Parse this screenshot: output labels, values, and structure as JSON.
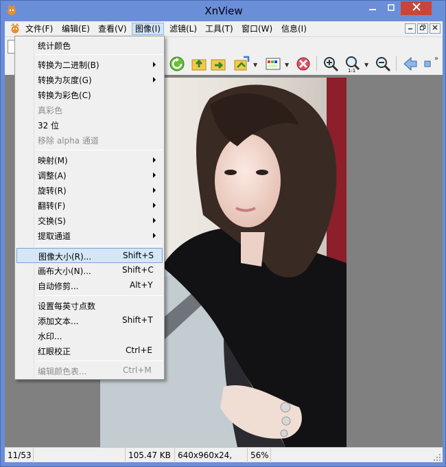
{
  "window": {
    "title": "XnView"
  },
  "menubar": {
    "items": [
      {
        "label": "文件(F)"
      },
      {
        "label": "编辑(E)"
      },
      {
        "label": "查看(V)"
      },
      {
        "label": "图像(I)"
      },
      {
        "label": "滤镜(L)"
      },
      {
        "label": "工具(T)"
      },
      {
        "label": "窗口(W)"
      },
      {
        "label": "信息(I)"
      }
    ]
  },
  "image_menu": {
    "items": [
      {
        "label": "统计颜色"
      },
      {
        "label": "转换为二进制(B)"
      },
      {
        "label": "转换为灰度(G)"
      },
      {
        "label": "转换为彩色(C)"
      },
      {
        "label": "真彩色"
      },
      {
        "label": "32 位"
      },
      {
        "label": "移除 alpha 通道"
      },
      {
        "label": "映射(M)"
      },
      {
        "label": "调整(A)"
      },
      {
        "label": "旋转(R)"
      },
      {
        "label": "翻转(F)"
      },
      {
        "label": "交换(S)"
      },
      {
        "label": "提取通道"
      },
      {
        "label": "图像大小(R)...",
        "shortcut": "Shift+S"
      },
      {
        "label": "画布大小(N)...",
        "shortcut": "Shift+C"
      },
      {
        "label": "自动修剪...",
        "shortcut": "Alt+Y"
      },
      {
        "label": "设置每英寸点数"
      },
      {
        "label": "添加文本...",
        "shortcut": "Shift+T"
      },
      {
        "label": "水印..."
      },
      {
        "label": "红眼校正",
        "shortcut": "Ctrl+E"
      },
      {
        "label": "编辑颜色表...",
        "shortcut": "Ctrl+M"
      }
    ]
  },
  "statusbar": {
    "position": "11/53",
    "filesize": "105.47 KB",
    "dimensions": "640x960x24, 0.67",
    "zoom": "56%"
  },
  "toolbar": {
    "overflow": "»"
  },
  "colors": {
    "frame": "#6a8ed8",
    "close_button": "#c7453a",
    "highlight": "#d4e6f8",
    "disabled_text": "#8d8d8d"
  },
  "icons": [
    "refresh-icon",
    "prev-folder-icon",
    "next-folder-icon",
    "adjust-image-icon",
    "palette-icon",
    "delete-icon",
    "zoom-in-icon",
    "zoom-one-to-one-icon",
    "zoom-out-icon",
    "back-arrow-icon"
  ]
}
